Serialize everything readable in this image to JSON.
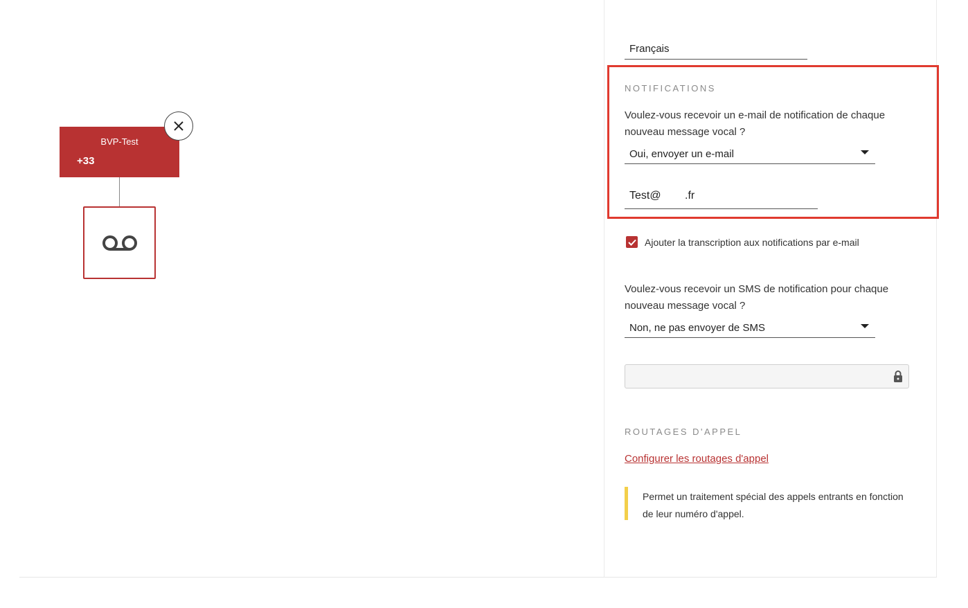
{
  "diagram": {
    "node_name": "BVP-Test",
    "node_number": "+33"
  },
  "panel": {
    "language_value": "Français",
    "notifications": {
      "title": "NOTIFICATIONS",
      "email_question": "Voulez-vous recevoir un e-mail de notification de chaque nouveau message vocal ?",
      "email_select_value": "Oui, envoyer un e-mail",
      "email_value_part1": "Test@",
      "email_value_part2": ".fr",
      "transcription_label": "Ajouter la transcription aux notifications par e-mail",
      "transcription_checked": true,
      "sms_question": "Voulez-vous recevoir un SMS de notification pour chaque nouveau message vocal ?",
      "sms_select_value": "Non, ne pas envoyer de SMS"
    },
    "routing": {
      "title": "ROUTAGES D'APPEL",
      "link_label": "Configurer les routages d'appel",
      "info_text": "Permet un traitement spécial des appels entrants en fonction de leur numéro d'appel."
    }
  },
  "colors": {
    "accent": "#b83232",
    "highlight": "#e03a2f",
    "info_bar": "#f3cf4a"
  }
}
